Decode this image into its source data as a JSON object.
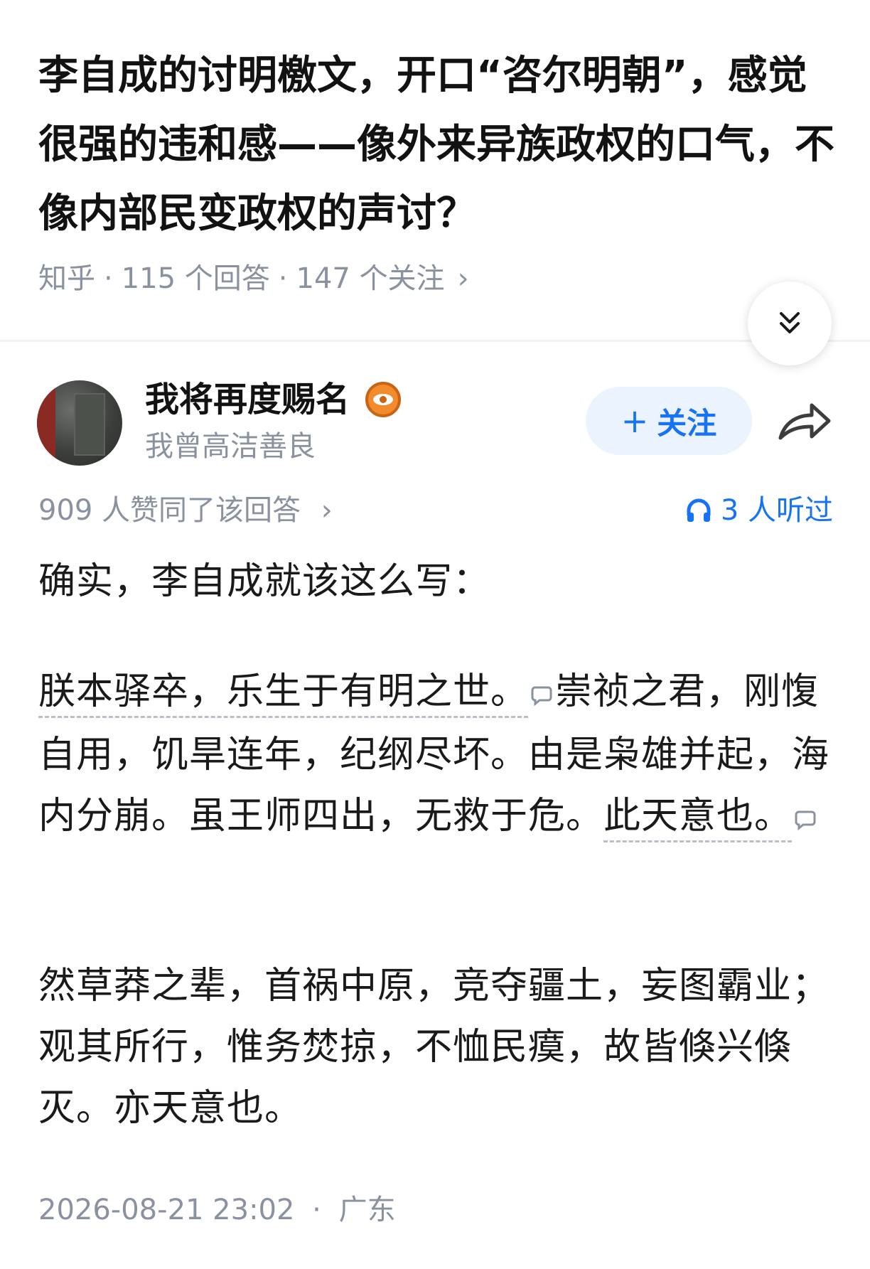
{
  "question": {
    "title": "李自成的讨明檄文，开口“咨尔明朝”，感觉很强的违和感——像外来异族政权的口气，不像内部民变政权的声讨？",
    "source": "知乎",
    "answers": "115 个回答",
    "followers": "147 个关注",
    "separator": "·",
    "chevron": "›"
  },
  "expand_icon": "double-chevron-down-icon",
  "author": {
    "name": "我将再度赐名",
    "bio": "我曾高洁善良",
    "badge_icon": "eye-badge-icon",
    "follow_plus": "+",
    "follow_label": "关注",
    "share_icon": "share-arrow-icon"
  },
  "answer_meta": {
    "votes": "909 人赞同了该回答",
    "chevron": "›",
    "listened": "3 人听过",
    "listened_icon": "headphones-icon"
  },
  "content": {
    "p1": "确实，李自成就该这么写：",
    "p2_a": "朕本驿卒，乐生于有明之世。",
    "p2_b": "崇祯之君，刚愎自用，饥旱连年，纪纲尽坏。由是枭雄并起，海内分崩。虽王师四出，无救于危。",
    "p2_c": "此天意也。",
    "p3": "然草莽之辈，首祸中原，竞夺疆土，妄图霸业；观其所行，惟务焚掠，不恤民瘼，故皆倏兴倏灭。亦天意也。"
  },
  "footer": {
    "datetime": "2026-08-21 23:02",
    "separator": "·",
    "location": "广东"
  },
  "colors": {
    "accent": "#1772f6",
    "muted": "#8a919f",
    "follow_bg": "#ebf3ff",
    "badge": "#f28a2e"
  }
}
